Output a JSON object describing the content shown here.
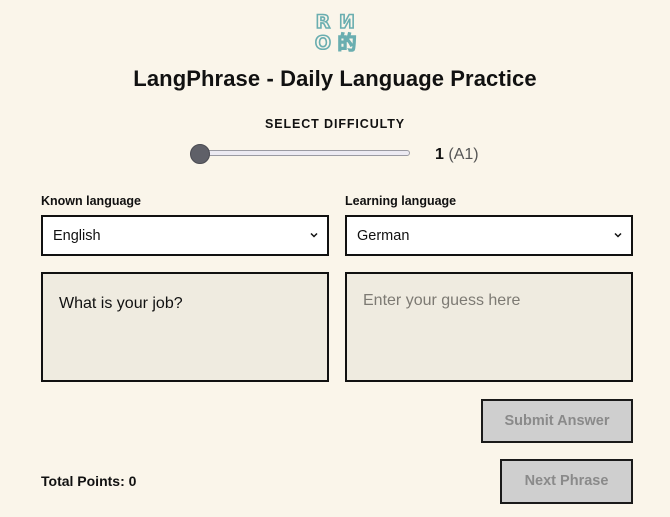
{
  "logo": {
    "glyphs": [
      "R",
      "И",
      "O",
      "的"
    ],
    "color": "#6aaeb0"
  },
  "app": {
    "title": "LangPhrase - Daily Language Practice"
  },
  "difficulty": {
    "label": "SELECT DIFFICULTY",
    "level": "1",
    "level_detail": "(A1)",
    "slider_fraction": 0
  },
  "known": {
    "label": "Known language",
    "selected": "English"
  },
  "learning": {
    "label": "Learning language",
    "selected": "German"
  },
  "phrase": {
    "text": "What is your job?"
  },
  "guess": {
    "value": "",
    "placeholder": "Enter your guess here"
  },
  "actions": {
    "submit_label": "Submit Answer",
    "next_label": "Next Phrase"
  },
  "score": {
    "label": "Total Points: 0"
  },
  "colors": {
    "background": "#faf5ea",
    "panel": "#efebe0",
    "disabled_button": "#cfcfcf",
    "accent_logo": "#6aaeb0"
  }
}
